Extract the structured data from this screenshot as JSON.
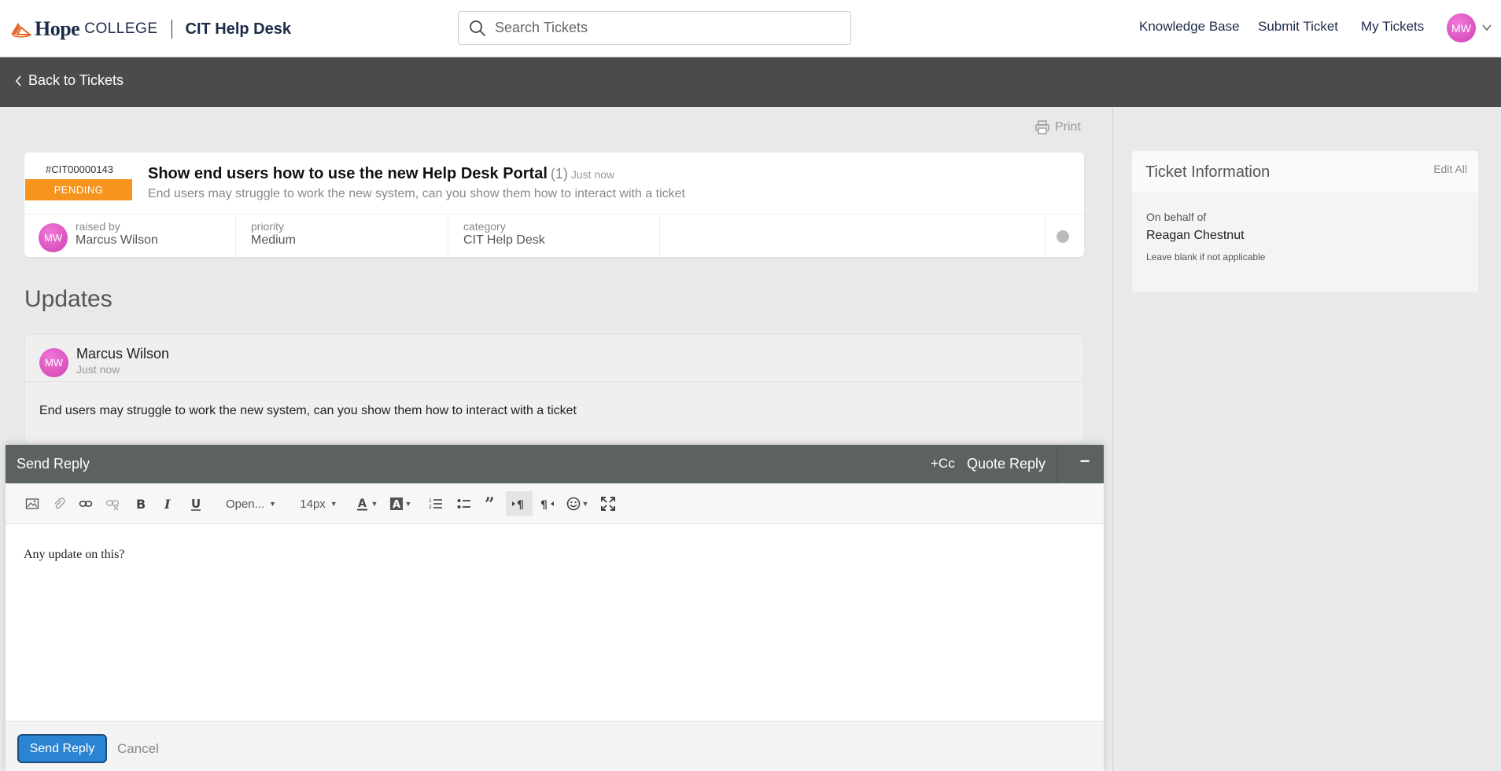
{
  "brand": {
    "name_main": "Hope",
    "name_sub": "COLLEGE",
    "app_name": "CIT Help Desk"
  },
  "search": {
    "placeholder": "Search Tickets"
  },
  "nav": {
    "knowledge_base": "Knowledge Base",
    "submit_ticket": "Submit Ticket",
    "my_tickets": "My Tickets"
  },
  "user": {
    "initials": "MW"
  },
  "backbar": {
    "back_label": "Back to Tickets"
  },
  "print_label": "Print",
  "ticket": {
    "id": "#CIT00000143",
    "status": "PENDING",
    "title": "Show end users how to use the new Help Desk Portal",
    "count": "(1)",
    "time": "Just now",
    "description": "End users may struggle to work the new system, can you show them how to interact with a ticket",
    "raised_by_label": "raised by",
    "raised_by": "Marcus Wilson",
    "raised_by_initials": "MW",
    "priority_label": "priority",
    "priority": "Medium",
    "category_label": "category",
    "category": "CIT Help Desk"
  },
  "updates": {
    "heading": "Updates",
    "items": [
      {
        "author": "Marcus Wilson",
        "initials": "MW",
        "time": "Just now",
        "body": "End users may struggle to work the new system, can you show them how to interact with a ticket"
      }
    ]
  },
  "ticket_info": {
    "title": "Ticket Information",
    "edit_all": "Edit All",
    "on_behalf_label": "On behalf of",
    "on_behalf_value": "Reagan Chestnut",
    "hint": "Leave blank if not applicable"
  },
  "reply": {
    "title": "Send Reply",
    "cc": "+Cc",
    "quote": "Quote Reply",
    "minimize": "−",
    "font_family": "Open...",
    "font_size": "14px",
    "content": "Any update on this?",
    "send_label": "Send Reply",
    "cancel_label": "Cancel"
  },
  "colors": {
    "status_pending": "#f7941d",
    "header_dark": "#4a4b4a",
    "reply_header": "#5c6262",
    "send_button": "#2a84d2",
    "avatar": "#e05cc4"
  }
}
